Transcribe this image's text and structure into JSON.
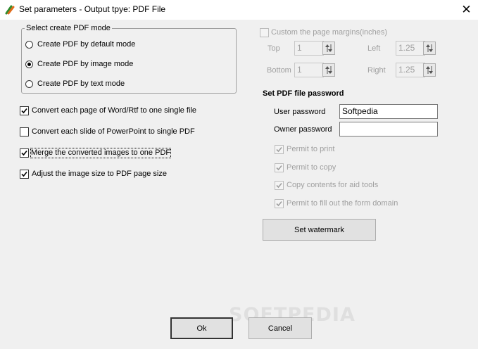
{
  "window": {
    "title": "Set parameters - Output tpye: PDF File",
    "close_symbol": "✕"
  },
  "pdf_mode": {
    "legend": "Select create PDF mode",
    "options": [
      {
        "label": "Create PDF by default mode",
        "selected": false
      },
      {
        "label": "Create PDF by image mode",
        "selected": true
      },
      {
        "label": "Create PDF by text mode",
        "selected": false
      }
    ]
  },
  "options": [
    {
      "label": "Convert each page of Word/Rtf to one single file",
      "checked": true
    },
    {
      "label": "Convert each slide of PowerPoint to single PDF",
      "checked": false
    },
    {
      "label": "Merge the converted images to one PDF",
      "checked": true
    },
    {
      "label": "Adjust the image size to PDF page size",
      "checked": true
    }
  ],
  "margins": {
    "checkbox_label": "Custom the page margins(inches)",
    "enabled": false,
    "top_label": "Top",
    "top_value": "1",
    "bottom_label": "Bottom",
    "bottom_value": "1",
    "left_label": "Left",
    "left_value": "1.25",
    "right_label": "Right",
    "right_value": "1.25"
  },
  "password": {
    "heading": "Set PDF file password",
    "user_label": "User password",
    "user_value": "Softpedia",
    "owner_label": "Owner password",
    "owner_value": "",
    "permissions": [
      {
        "label": "Permit to print",
        "checked": true
      },
      {
        "label": "Permit to copy",
        "checked": true
      },
      {
        "label": "Copy contents for aid tools",
        "checked": true
      },
      {
        "label": "Permit to fill out the form domain",
        "checked": true
      }
    ]
  },
  "buttons": {
    "watermark": "Set watermark",
    "ok": "Ok",
    "cancel": "Cancel"
  },
  "overlay_watermark": "SOFTPEDIA"
}
